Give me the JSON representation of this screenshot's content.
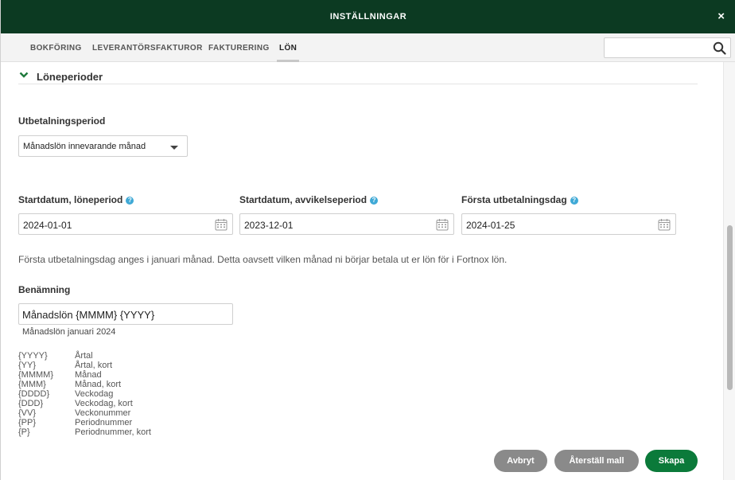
{
  "title": "INSTÄLLNINGAR",
  "close_glyph": "×",
  "tabs": [
    {
      "label": "BOKFÖRING"
    },
    {
      "label": "LEVERANTÖRSFAKTUROR"
    },
    {
      "label": "FAKTURERING"
    },
    {
      "label": "LÖN"
    }
  ],
  "active_tab": "LÖN",
  "search": {
    "value": "",
    "placeholder": ""
  },
  "section": {
    "title": "Löneperioder"
  },
  "payment_period": {
    "label": "Utbetalningsperiod",
    "selected": "Månadslön innevarande månad"
  },
  "dates": {
    "start_pay": {
      "label": "Startdatum, löneperiod",
      "value": "2024-01-01"
    },
    "start_deviation": {
      "label": "Startdatum, avvikelseperiod",
      "value": "2023-12-01"
    },
    "first_payday": {
      "label": "Första utbetalningsdag",
      "value": "2024-01-25"
    }
  },
  "help_glyph": "?",
  "note": "Första utbetalningsdag anges i januari månad. Detta oavsett vilken månad ni börjar betala ut er lön för i Fortnox lön.",
  "naming": {
    "label": "Benämning",
    "value": "Månadslön {MMMM} {YYYY}",
    "preview": "Månadslön januari 2024"
  },
  "tokens": [
    {
      "token": "{YYYY}",
      "desc": "Årtal"
    },
    {
      "token": "{YY}",
      "desc": "Årtal, kort"
    },
    {
      "token": "{MMMM}",
      "desc": "Månad"
    },
    {
      "token": "{MMM}",
      "desc": "Månad, kort"
    },
    {
      "token": "{DDDD}",
      "desc": "Veckodag"
    },
    {
      "token": "{DDD}",
      "desc": "Veckodag, kort"
    },
    {
      "token": "{VV}",
      "desc": "Veckonummer"
    },
    {
      "token": "{PP}",
      "desc": "Periodnummer"
    },
    {
      "token": "{P}",
      "desc": "Periodnummer, kort"
    }
  ],
  "buttons": {
    "cancel": "Avbryt",
    "reset": "Återställ mall",
    "create": "Skapa"
  },
  "colors": {
    "header_bg": "#0c3a22",
    "primary_button": "#0b7a3a",
    "secondary_button": "#8a8a8a",
    "help_icon": "#3fa9d6"
  }
}
